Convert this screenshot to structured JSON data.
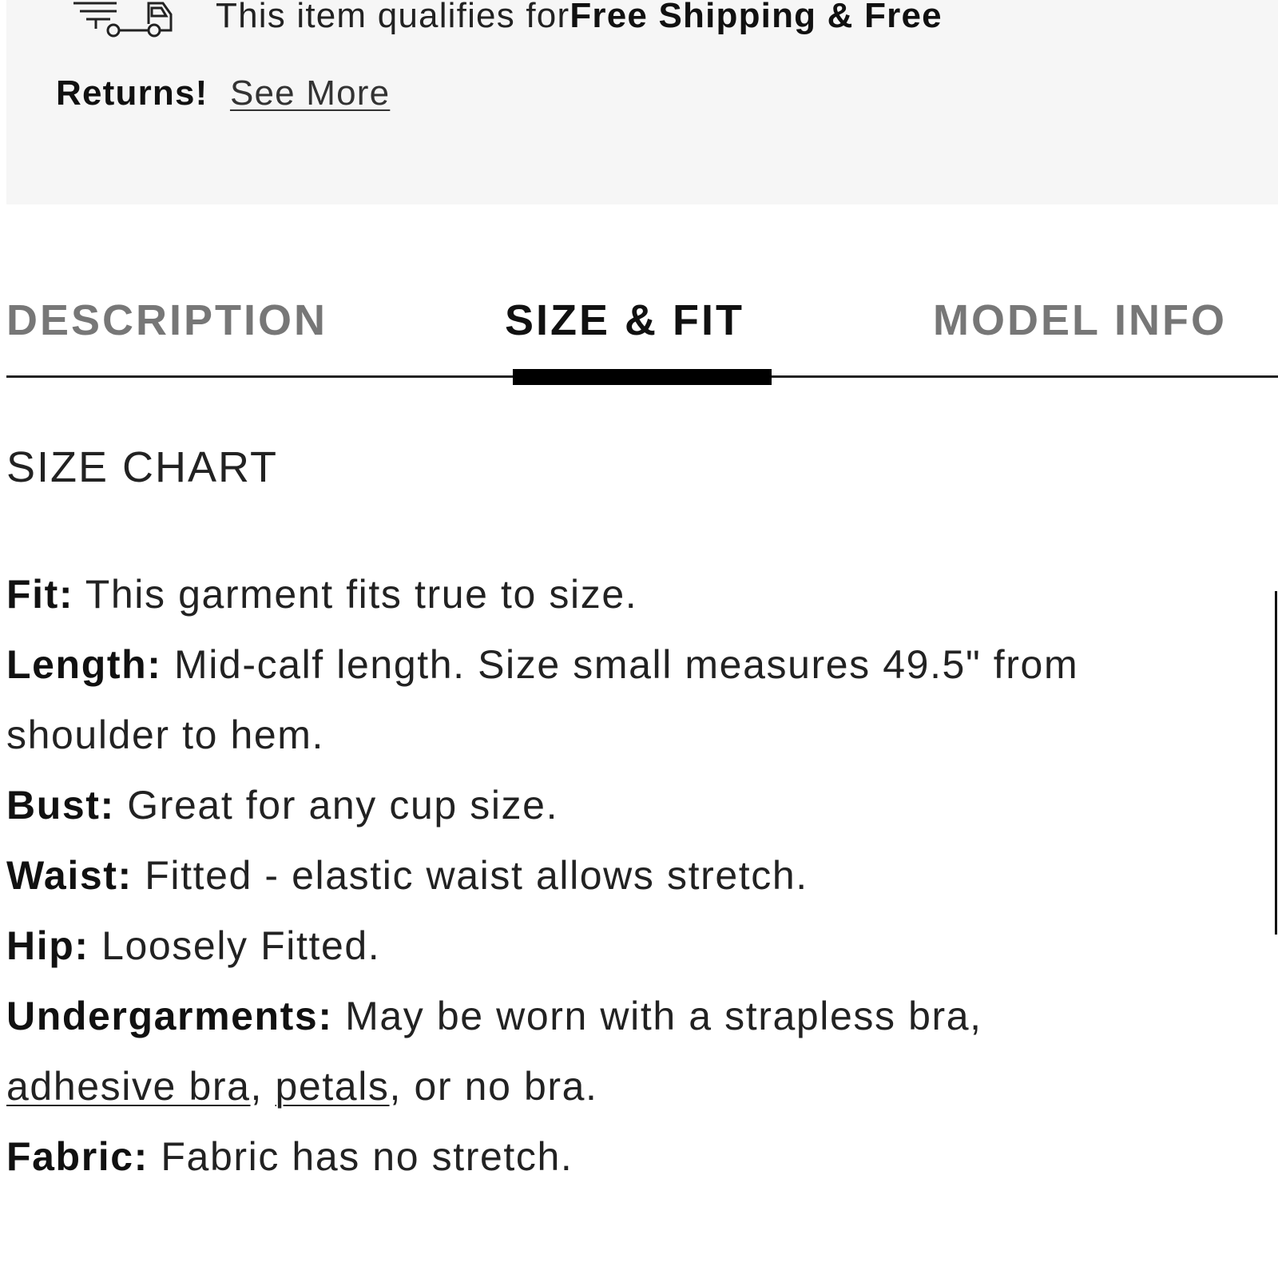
{
  "shipping": {
    "icon": "delivery-truck-icon",
    "text_prefix": "This item qualifies for ",
    "text_bold_1": "Free Shipping & Free",
    "text_bold_2": "Returns!",
    "link": "See More"
  },
  "tabs": [
    {
      "label": "DESCRIPTION",
      "active": false
    },
    {
      "label": "SIZE & FIT",
      "active": true
    },
    {
      "label": "MODEL INFO",
      "active": false
    }
  ],
  "size_chart": {
    "heading": "SIZE CHART"
  },
  "fit_details": {
    "fit": {
      "label": "Fit:",
      "text": " This garment fits true to size."
    },
    "length": {
      "label": "Length:",
      "text_line1": " Mid-calf length. Size small measures 49.5\" from",
      "text_line2": "shoulder to hem."
    },
    "bust": {
      "label": "Bust:",
      "text": " Great for any cup size."
    },
    "waist": {
      "label": "Waist:",
      "text": " Fitted - elastic waist allows stretch."
    },
    "hip": {
      "label": "Hip:",
      "text": " Loosely Fitted."
    },
    "undergarments": {
      "label": "Undergarments:",
      "text_line1": " May be worn with a strapless bra,",
      "link_1": "adhesive bra",
      "sep": ", ",
      "link_2": "petals",
      "text_end": ", or no bra."
    },
    "fabric": {
      "label": "Fabric:",
      "text": " Fabric has no stretch."
    }
  },
  "colors": {
    "banner_bg": "#f6f6f6",
    "active_tab": "#111111",
    "inactive_tab": "#777777",
    "text": "#222222"
  }
}
